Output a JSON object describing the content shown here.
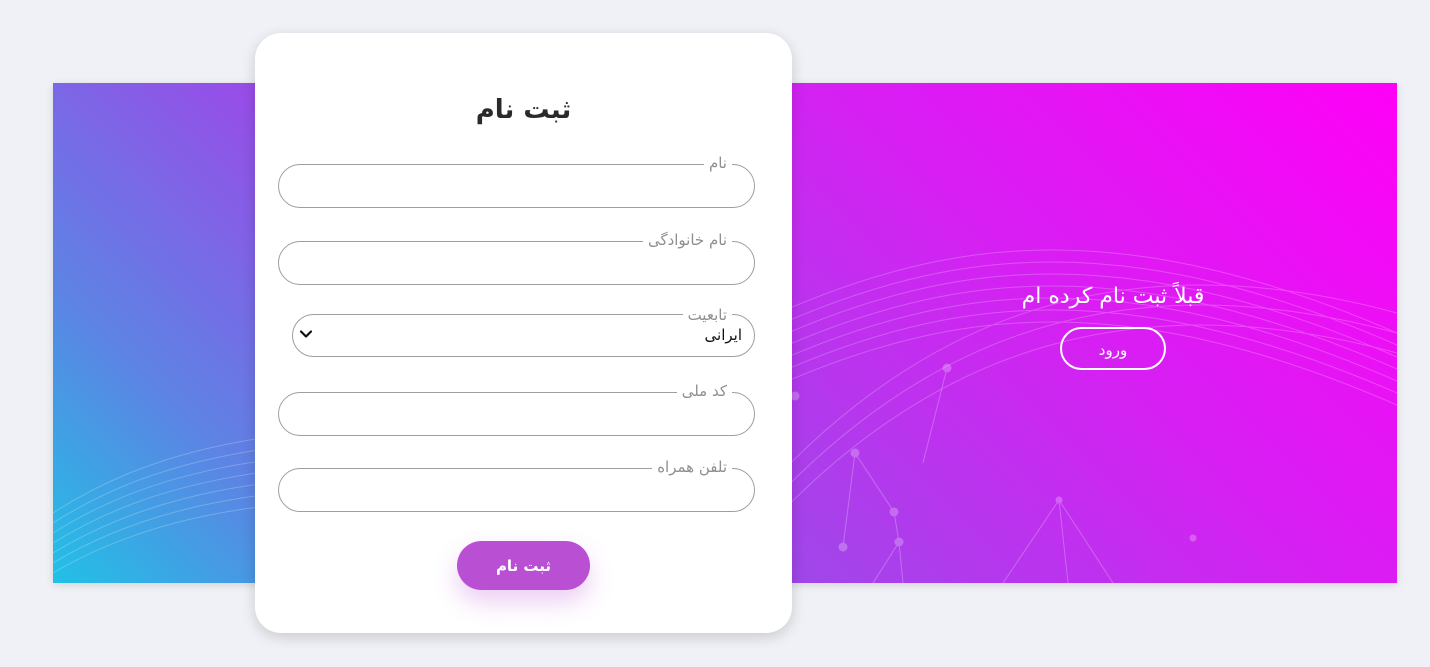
{
  "register": {
    "title": "ثبت نام",
    "fields": {
      "first_name": {
        "label": "نام",
        "value": ""
      },
      "last_name": {
        "label": "نام خانوادگی",
        "value": ""
      },
      "nationality": {
        "label": "تابعیت",
        "value": "ایرانی"
      },
      "national_code": {
        "label": "کد ملی",
        "value": ""
      },
      "mobile": {
        "label": "تلفن همراه",
        "value": ""
      }
    },
    "submit_label": "ثبت نام"
  },
  "login": {
    "prompt": "قبلاً ثبت نام کرده ام",
    "button_label": "ورود"
  },
  "colors": {
    "page_background": "#eff1f6",
    "gradient_magenta": "#ff00f7",
    "gradient_purple": "#9a4be8",
    "gradient_cyan": "#21c1e5",
    "submit_button": "#b94fd3",
    "card": "#ffffff"
  },
  "icons": {
    "select_chevron": "chevron-down-icon"
  }
}
